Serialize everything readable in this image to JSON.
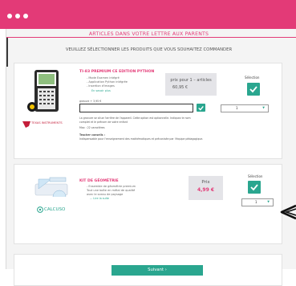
{
  "page_title": "ARTICLES DANS VOTRE LETTRE AUX PARENTS",
  "subtitle": "VEUILLEZ SÉLECTIONNER LES PRODUITS QUE VOUS SOUHAITEZ COMMANDER",
  "product1": {
    "title": "TI-83 PREMIUM CE EDITION PYTHON",
    "bullets": [
      "- Mode Examen intégré",
      "- Application Python intégrée",
      "- Insertion d'images"
    ],
    "stock": "En savoir plus",
    "brand": "TEXAS INSTRUMENTS",
    "price_label": "prix pour 1 – articles",
    "price": "60,95 €",
    "selection_label": "Sélection",
    "engrave_label": "gravure + 3,95 €",
    "engrave_note": "La gravure se situe l'arrière de l'appareil. Cette option est optionnelle. Indiquez le nom",
    "engrave_note2": "complet et le prénom de votre enfant",
    "max_chars": "Max : 22 caractères",
    "teacher_label": "Teacher conseils :",
    "teacher_note": "Indispensable pour l'enseignement des mathématiques et préconisée par l'équipe pédagogique.",
    "quantity": "1"
  },
  "product2": {
    "title": "KIT DE GÉOMÉTRIE",
    "bullets": [
      "- Ensemble de géométrie premium",
      "  Tout une boîte en métal de qualité",
      "  avec le sceau de paysage"
    ],
    "more": "... Lire la suite",
    "brand": "CALCUSO",
    "price_label": "Prix",
    "price": "4,99 €",
    "selection_label": "Sélection",
    "quantity": "1"
  },
  "next_button": "Suivant ›",
  "colors": {
    "accent": "#e33a77",
    "green": "#2aa68f"
  }
}
